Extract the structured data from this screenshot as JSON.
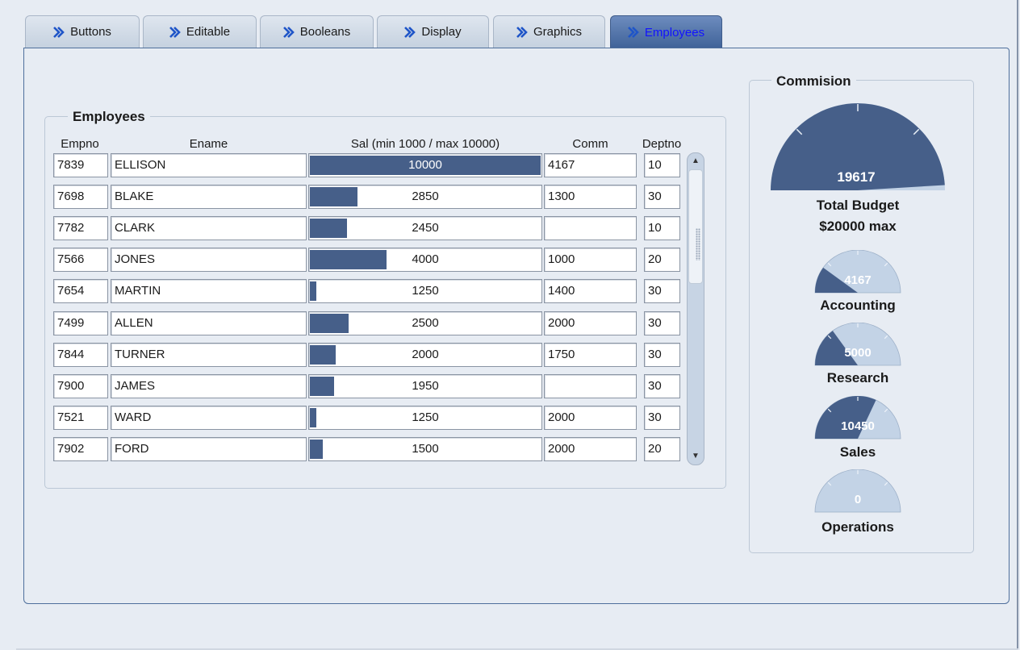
{
  "tabs": [
    {
      "label": "Buttons",
      "active": false
    },
    {
      "label": "Editable",
      "active": false
    },
    {
      "label": "Booleans",
      "active": false
    },
    {
      "label": "Display",
      "active": false
    },
    {
      "label": "Graphics",
      "active": false
    },
    {
      "label": "Employees",
      "active": true
    }
  ],
  "employees": {
    "title": "Employees",
    "columns": {
      "empno": "Empno",
      "ename": "Ename",
      "sal": "Sal (min 1000 / max 10000)",
      "comm": "Comm",
      "deptno": "Deptno"
    },
    "sal_range": [
      1000,
      10000
    ],
    "rows": [
      {
        "empno": "7839",
        "ename": "ELLISON",
        "sal": "10000",
        "comm": "4167",
        "deptno": "10"
      },
      {
        "empno": "7698",
        "ename": "BLAKE",
        "sal": "2850",
        "comm": "1300",
        "deptno": "30"
      },
      {
        "empno": "7782",
        "ename": "CLARK",
        "sal": "2450",
        "comm": "",
        "deptno": "10"
      },
      {
        "empno": "7566",
        "ename": "JONES",
        "sal": "4000",
        "comm": "1000",
        "deptno": "20"
      },
      {
        "empno": "7654",
        "ename": "MARTIN",
        "sal": "1250",
        "comm": "1400",
        "deptno": "30"
      },
      {
        "empno": "7499",
        "ename": "ALLEN",
        "sal": "2500",
        "comm": "2000",
        "deptno": "30"
      },
      {
        "empno": "7844",
        "ename": "TURNER",
        "sal": "2000",
        "comm": "1750",
        "deptno": "30"
      },
      {
        "empno": "7900",
        "ename": "JAMES",
        "sal": "1950",
        "comm": "",
        "deptno": "30"
      },
      {
        "empno": "7521",
        "ename": "WARD",
        "sal": "1250",
        "comm": "2000",
        "deptno": "30"
      },
      {
        "empno": "7902",
        "ename": "FORD",
        "sal": "1500",
        "comm": "2000",
        "deptno": "20"
      }
    ]
  },
  "commission": {
    "title": "Commision",
    "total": {
      "value": "19617",
      "max": 20000,
      "label1": "Total Budget",
      "label2": "$20000 max"
    },
    "departments": [
      {
        "name": "Accounting",
        "value": "4167",
        "fraction": 0.2
      },
      {
        "name": "Research",
        "value": "5000",
        "fraction": 0.3
      },
      {
        "name": "Sales",
        "value": "10450",
        "fraction": 0.64
      },
      {
        "name": "Operations",
        "value": "0",
        "fraction": 0
      }
    ]
  },
  "colors": {
    "bar": "#465f89",
    "gauge_fill": "#465f89",
    "gauge_empty": "#c3d3e6",
    "active_tab_text": "#1212ff"
  },
  "icons": {
    "tab": "double-chevron-right-icon",
    "scroll_up": "arrow-up-icon",
    "scroll_down": "arrow-down-icon"
  }
}
